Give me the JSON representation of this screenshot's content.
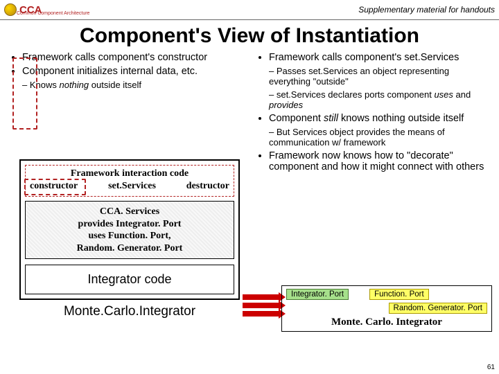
{
  "header": {
    "logo_text": "CCA",
    "logo_sub": "Common Component Architecture",
    "supplementary": "Supplementary material for handouts"
  },
  "title": "Component's View of Instantiation",
  "left_bullets": {
    "b1": "Framework calls component's constructor",
    "b2": "Component initializes internal data, etc.",
    "s1_pre": "Knows ",
    "s1_em": "nothing",
    "s1_post": " outside itself"
  },
  "right_bullets": {
    "b1": "Framework calls component's set.Services",
    "s1": "Passes set.Services an object representing everything \"outside\"",
    "s2_pre": "set.Services declares ports component ",
    "s2_uses": "uses",
    "s2_and": " and ",
    "s2_provides": "provides",
    "b2_pre": "Component ",
    "b2_em": "still",
    "b2_post": " knows nothing outside itself",
    "s3": "But Services object provides the means of communication w/ framework",
    "b3": "Framework now knows how to \"decorate\" component and how it might connect with others"
  },
  "diagram": {
    "fw_title": "Framework interaction code",
    "fw_constructor": "constructor",
    "fw_setservices": "set.Services",
    "fw_destructor": "destructor",
    "svc_l1": "CCA. Services",
    "svc_l2": "provides Integrator. Port",
    "svc_l3": "uses Function. Port,",
    "svc_l4": "Random. Generator. Port",
    "int_code": "Integrator code",
    "mc_label": "Monte.Carlo.Integrator"
  },
  "ports": {
    "p1": "Integrator. Port",
    "p2": "Function. Port",
    "p3": "Random. Generator. Port",
    "label": "Monte. Carlo. Integrator"
  },
  "page_number": "61"
}
